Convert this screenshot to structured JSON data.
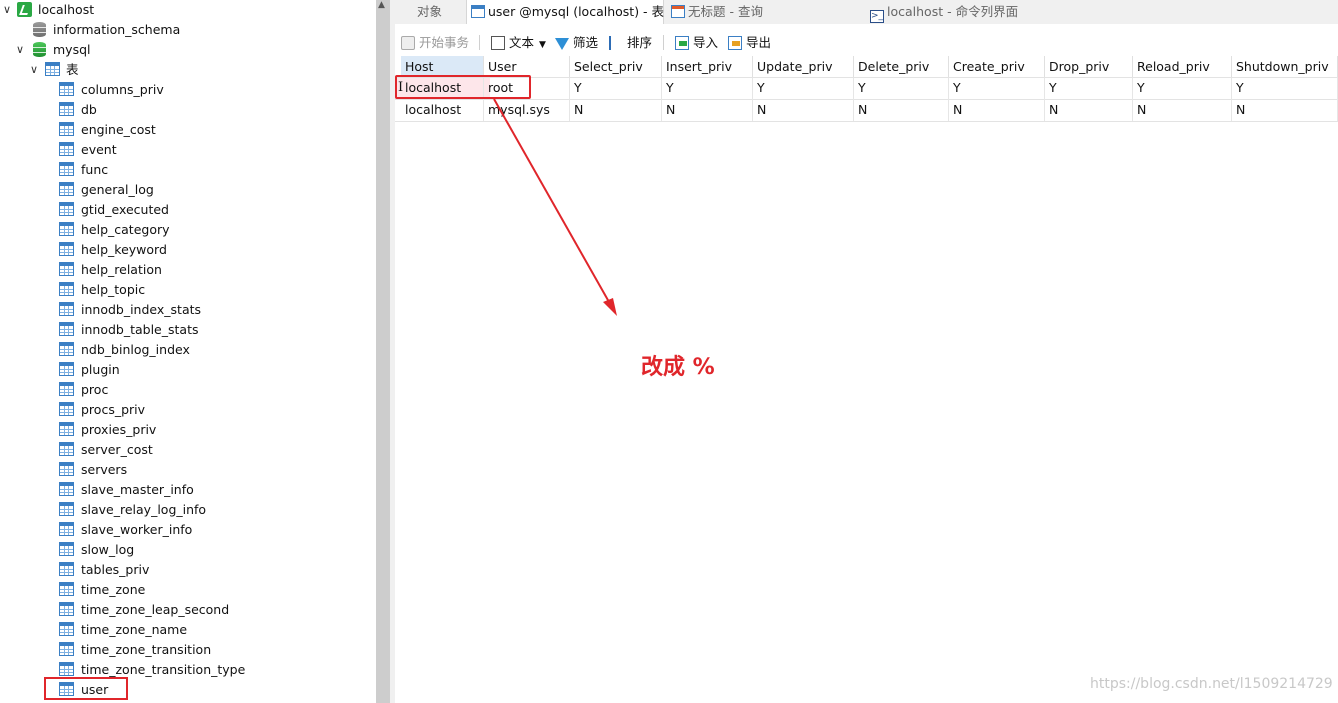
{
  "tree": {
    "connection": "localhost",
    "databases": [
      {
        "name": "information_schema"
      },
      {
        "name": "mysql"
      }
    ],
    "tables_group": "表",
    "tables": [
      "columns_priv",
      "db",
      "engine_cost",
      "event",
      "func",
      "general_log",
      "gtid_executed",
      "help_category",
      "help_keyword",
      "help_relation",
      "help_topic",
      "innodb_index_stats",
      "innodb_table_stats",
      "ndb_binlog_index",
      "plugin",
      "proc",
      "procs_priv",
      "proxies_priv",
      "server_cost",
      "servers",
      "slave_master_info",
      "slave_relay_log_info",
      "slave_worker_info",
      "slow_log",
      "tables_priv",
      "time_zone",
      "time_zone_leap_second",
      "time_zone_name",
      "time_zone_transition",
      "time_zone_transition_type",
      "user"
    ]
  },
  "tabs": [
    {
      "label": "对象"
    },
    {
      "label": "user @mysql (localhost) - 表"
    },
    {
      "label": "无标题 - 查询"
    },
    {
      "label": "localhost - 命令列界面"
    }
  ],
  "toolbar": {
    "begin_transaction": "开始事务",
    "text": "文本",
    "filter": "筛选",
    "sort": "排序",
    "import": "导入",
    "export": "导出"
  },
  "grid": {
    "columns": [
      "Host",
      "User",
      "Select_priv",
      "Insert_priv",
      "Update_priv",
      "Delete_priv",
      "Create_priv",
      "Drop_priv",
      "Reload_priv",
      "Shutdown_priv"
    ],
    "rows": [
      [
        "localhost",
        "root",
        "Y",
        "Y",
        "Y",
        "Y",
        "Y",
        "Y",
        "Y",
        "Y"
      ],
      [
        "localhost",
        "mysql.sys",
        "N",
        "N",
        "N",
        "N",
        "N",
        "N",
        "N",
        "N"
      ]
    ]
  },
  "annotation": "改成 %",
  "watermark": "https://blog.csdn.net/l1509214729",
  "colors": {
    "annotation_red": "#e0262b",
    "selected_header": "#dbe9f7",
    "selected_cell": "#fde6ea"
  }
}
